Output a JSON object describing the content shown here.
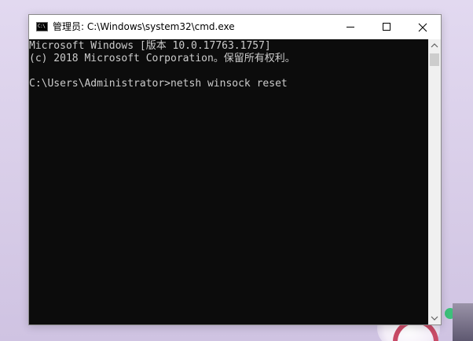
{
  "window": {
    "title": "管理员: C:\\Windows\\system32\\cmd.exe",
    "app_icon_glyph": "C:\\",
    "controls": [
      "minimize",
      "maximize",
      "close"
    ]
  },
  "console": {
    "lines": [
      "Microsoft Windows [版本 10.0.17763.1757]",
      "(c) 2018 Microsoft Corporation。保留所有权利。",
      "",
      "C:\\Users\\Administrator>netsh winsock reset"
    ],
    "text_color": "#cccccc",
    "background_color": "#0c0c0c"
  },
  "icons": {
    "app": "cmd-icon",
    "minimize": "minimize-icon",
    "maximize": "maximize-icon",
    "close": "close-icon",
    "scroll_up": "chevron-up-icon",
    "scroll_down": "chevron-down-icon"
  }
}
